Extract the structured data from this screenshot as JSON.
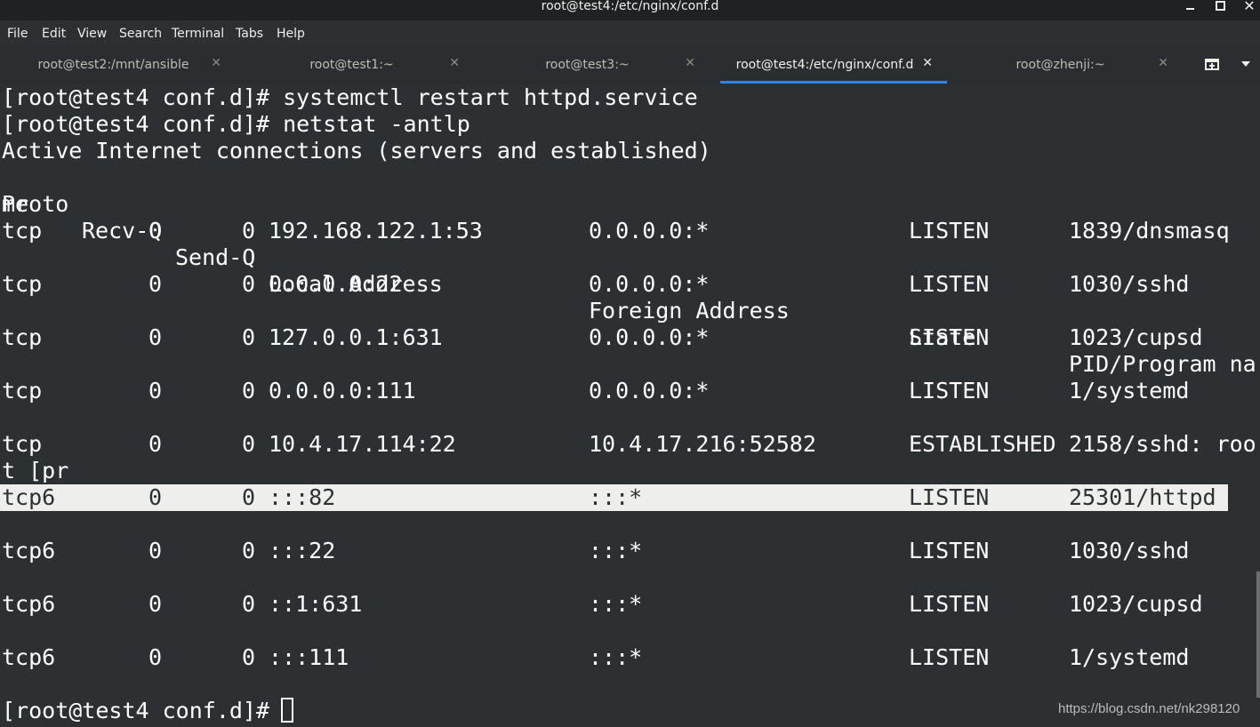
{
  "window": {
    "title": "root@test4:/etc/nginx/conf.d",
    "minimize_glyph": "–",
    "close_glyph": "✕"
  },
  "menu": [
    "File",
    "Edit",
    "View",
    "Search",
    "Terminal",
    "Tabs",
    "Help"
  ],
  "tabs": [
    {
      "label": "root@test2:/mnt/ansible",
      "active": false
    },
    {
      "label": "root@test1:~",
      "active": false
    },
    {
      "label": "root@test3:~",
      "active": false
    },
    {
      "label": "root@test4:/etc/nginx/conf.d",
      "active": true
    },
    {
      "label": "root@zhenji:~",
      "active": false
    }
  ],
  "tab_close_glyph": "✕",
  "icons": {
    "new_tab": "new-tab-icon",
    "tab_menu": "chevron-down-icon"
  },
  "terminal": {
    "lines": [
      "[root@test4 conf.d]# systemctl restart httpd.service",
      "[root@test4 conf.d]# netstat -antlp",
      "Active Internet connections (servers and established)"
    ],
    "header": [
      "Proto",
      "Recv-Q",
      "Send-Q",
      "Local Address",
      "Foreign Address",
      "State",
      "PID/Program na"
    ],
    "header_wrap": "me",
    "rows": [
      {
        "proto": "tcp",
        "recvq": "0",
        "sendq": "0",
        "local": "192.168.122.1:53",
        "foreign": "0.0.0.0:*",
        "state": "LISTEN",
        "pid": "1839/dnsmasq",
        "wrap": ""
      },
      {
        "proto": "tcp",
        "recvq": "0",
        "sendq": "0",
        "local": "0.0.0.0:22",
        "foreign": "0.0.0.0:*",
        "state": "LISTEN",
        "pid": "1030/sshd",
        "wrap": ""
      },
      {
        "proto": "tcp",
        "recvq": "0",
        "sendq": "0",
        "local": "127.0.0.1:631",
        "foreign": "0.0.0.0:*",
        "state": "LISTEN",
        "pid": "1023/cupsd",
        "wrap": ""
      },
      {
        "proto": "tcp",
        "recvq": "0",
        "sendq": "0",
        "local": "0.0.0.0:111",
        "foreign": "0.0.0.0:*",
        "state": "LISTEN",
        "pid": "1/systemd",
        "wrap": ""
      },
      {
        "proto": "tcp",
        "recvq": "0",
        "sendq": "0",
        "local": "10.4.17.114:22",
        "foreign": "10.4.17.216:52582",
        "state": "ESTABLISHED",
        "pid": "2158/sshd: roo",
        "wrap": "t [pr"
      },
      {
        "proto": "tcp6",
        "recvq": "0",
        "sendq": "0",
        "local": ":::82",
        "foreign": ":::*",
        "state": "LISTEN",
        "pid": "25301/httpd",
        "wrap": "",
        "highlighted": true
      },
      {
        "proto": "tcp6",
        "recvq": "0",
        "sendq": "0",
        "local": ":::22",
        "foreign": ":::*",
        "state": "LISTEN",
        "pid": "1030/sshd",
        "wrap": ""
      },
      {
        "proto": "tcp6",
        "recvq": "0",
        "sendq": "0",
        "local": "::1:631",
        "foreign": ":::*",
        "state": "LISTEN",
        "pid": "1023/cupsd",
        "wrap": ""
      },
      {
        "proto": "tcp6",
        "recvq": "0",
        "sendq": "0",
        "local": ":::111",
        "foreign": ":::*",
        "state": "LISTEN",
        "pid": "1/systemd",
        "wrap": ""
      }
    ],
    "prompt": "[root@test4 conf.d]# "
  },
  "watermark": "https://blog.csdn.net/nk298120",
  "colors": {
    "background": "#2d3033",
    "foreground": "#ffffff",
    "active_tab_accent": "#3584e4",
    "selection": "#eeeeec"
  }
}
